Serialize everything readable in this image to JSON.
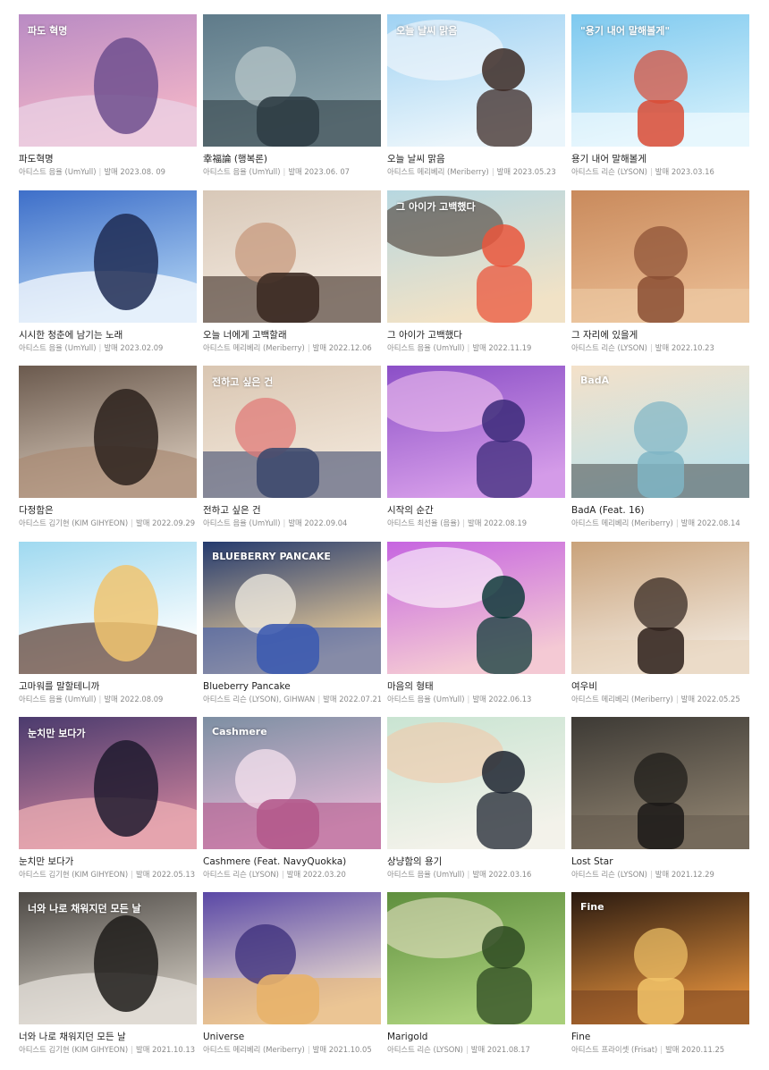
{
  "albums": [
    {
      "title": "파도혁명",
      "artist_label": "아티스트 음율 (UmYull)",
      "release_label": "발매 2023.08. 09",
      "cover_text": "파도 혁명",
      "colors": [
        "#b98bc4",
        "#f3b6c8",
        "#6f4f8e",
        "#e9d4e7"
      ]
    },
    {
      "title": "幸福論 (행복론)",
      "artist_label": "아티스트 음율 (UmYull)",
      "release_label": "발매 2023.06. 07",
      "cover_text": "",
      "colors": [
        "#5f7b8a",
        "#8fa6ad",
        "#2f3d45",
        "#b7c6c8"
      ]
    },
    {
      "title": "오늘 날씨 맑음",
      "artist_label": "아티스트 메리베리 (Meriberry)",
      "release_label": "발매 2023.05.23",
      "cover_text": "오늘 날씨 맑음",
      "colors": [
        "#9fd2f3",
        "#eaf5fb",
        "#3c2a25",
        "#f7f9fb"
      ]
    },
    {
      "title": "용기 내어 말해볼게",
      "artist_label": "아티스트 리슨 (LYSON)",
      "release_label": "발매 2023.03.16",
      "cover_text": "\"용기 내어 말해볼게\"",
      "colors": [
        "#7ec9ef",
        "#cfeefb",
        "#d94a34",
        "#ffffff"
      ]
    },
    {
      "title": "시시한 청춘에 남기는 노래",
      "artist_label": "아티스트 음율 (UmYull)",
      "release_label": "발매 2023.02.09",
      "cover_text": "",
      "colors": [
        "#3e6fc9",
        "#a9cdf1",
        "#1e2b54",
        "#ffffff"
      ]
    },
    {
      "title": "오늘 너에게 고백할래",
      "artist_label": "아티스트 메리베리 (Meriberry)",
      "release_label": "발매 2022.12.06",
      "cover_text": "",
      "colors": [
        "#d8c8b8",
        "#f3e9de",
        "#3b2a22",
        "#c79a7d"
      ]
    },
    {
      "title": "그 아이가 고백했다",
      "artist_label": "아티스트 음율 (UmYull)",
      "release_label": "발매 2022.11.19",
      "cover_text": "그 아이가 고백했다",
      "colors": [
        "#b7d7e0",
        "#f1e2c6",
        "#e9563c",
        "#4a3a32"
      ]
    },
    {
      "title": "그 자리에 있을게",
      "artist_label": "아티스트 리슨 (LYSON)",
      "release_label": "발매 2022.10.23",
      "cover_text": "",
      "colors": [
        "#c98a5c",
        "#e8b98f",
        "#8a4e33",
        "#f0d2ae"
      ]
    },
    {
      "title": "다정함은",
      "artist_label": "아티스트 김기현 (KIM GIHYEON)",
      "release_label": "발매 2022.09.29",
      "cover_text": "",
      "colors": [
        "#6b5a4e",
        "#d2c3b4",
        "#2b211c",
        "#a98a74"
      ]
    },
    {
      "title": "전하고 싶은 건",
      "artist_label": "아티스트 음율 (UmYull)",
      "release_label": "발매 2022.09.04",
      "cover_text": "전하고 싶은 건",
      "colors": [
        "#d9c6b2",
        "#f2e7da",
        "#3e4a6e",
        "#e07b78"
      ]
    },
    {
      "title": "시작의 순간",
      "artist_label": "아티스트 최선율 (음율)",
      "release_label": "발매 2022.08.19",
      "cover_text": "",
      "colors": [
        "#8b4fc7",
        "#d49be8",
        "#3b2a79",
        "#f3c4f0"
      ]
    },
    {
      "title": "BadA (Feat. 16)",
      "artist_label": "아티스트 메리베리 (Meriberry)",
      "release_label": "발매 2022.08.14",
      "cover_text": "BadA",
      "colors": [
        "#f4e1c9",
        "#bfe2ea",
        "#7fb5c4",
        "#3a3a3a"
      ]
    },
    {
      "title": "고마워를 말할테니까",
      "artist_label": "아티스트 음율 (UmYull)",
      "release_label": "발매 2022.08.09",
      "cover_text": "",
      "colors": [
        "#9fd9f0",
        "#ffffff",
        "#f0c470",
        "#5a3a2e"
      ]
    },
    {
      "title": "Blueberry Pancake",
      "artist_label": "아티스트 리슨 (LYSON), GIHWAN",
      "release_label": "발매 2022.07.21",
      "cover_text": "BLUEBERRY PANCAKE",
      "colors": [
        "#243a6e",
        "#f2d29a",
        "#3d5bb0",
        "#f5f0e4"
      ]
    },
    {
      "title": "마음의 형태",
      "artist_label": "아티스트 음율 (UmYull)",
      "release_label": "발매 2022.06.13",
      "cover_text": "",
      "colors": [
        "#c665e0",
        "#f4c9d4",
        "#0f3a3a",
        "#ffffff"
      ]
    },
    {
      "title": "여우비",
      "artist_label": "아티스트 메리베리 (Meriberry)",
      "release_label": "발매 2022.05.25",
      "cover_text": "",
      "colors": [
        "#c9a27a",
        "#f0e6da",
        "#2c1f1a",
        "#e6cfb6"
      ]
    },
    {
      "title": "눈치만 보다가",
      "artist_label": "아티스트 김기현 (KIM GIHYEON)",
      "release_label": "발매 2022.05.13",
      "cover_text": "눈치만 보다가",
      "colors": [
        "#4b3b6e",
        "#c9809a",
        "#1f1a2e",
        "#f1b4b7"
      ]
    },
    {
      "title": "Cashmere (Feat. NavyQuokka)",
      "artist_label": "아티스트 리슨 (LYSON)",
      "release_label": "발매 2022.03.20",
      "cover_text": "Cashmere",
      "colors": [
        "#7d8fa3",
        "#e4b9d6",
        "#b45a8c",
        "#f7e3ef"
      ]
    },
    {
      "title": "상냥함의 용기",
      "artist_label": "아티스트 음율 (UmYull)",
      "release_label": "발매 2022.03.16",
      "cover_text": "",
      "colors": [
        "#c9e4d2",
        "#f3f2ea",
        "#1d2430",
        "#f1c8a8"
      ]
    },
    {
      "title": "Lost Star",
      "artist_label": "아티스트 리슨 (LYSON)",
      "release_label": "발매 2021.12.29",
      "cover_text": "",
      "colors": [
        "#3d3a35",
        "#8a7e6c",
        "#1a1816",
        "#5f564a"
      ]
    },
    {
      "title": "너와 나로 채워지던 모든 날",
      "artist_label": "아티스트 김기현 (KIM GIHYEON)",
      "release_label": "발매 2021.10.13",
      "cover_text": "너와 나로 채워지던 모든 날",
      "colors": [
        "#4e4a46",
        "#c8c2b8",
        "#1f1c1a",
        "#eae6df"
      ]
    },
    {
      "title": "Universe",
      "artist_label": "아티스트 메리베리 (Meriberry)",
      "release_label": "발매 2021.10.05",
      "cover_text": "",
      "colors": [
        "#5a48a6",
        "#efe0d2",
        "#e8b36a",
        "#3a2c7a"
      ]
    },
    {
      "title": "Marigold",
      "artist_label": "아티스트 리슨 (LYSON)",
      "release_label": "발매 2021.08.17",
      "cover_text": "",
      "colors": [
        "#5f8f3e",
        "#a9cf7a",
        "#2e4a22",
        "#e8e2c6"
      ]
    },
    {
      "title": "Fine",
      "artist_label": "아티스트 프라이셋 (Frisat)",
      "release_label": "발매 2020.11.25",
      "cover_text": "Fine",
      "colors": [
        "#2a1a10",
        "#d98a3a",
        "#f2c46a",
        "#6b3a1e"
      ]
    }
  ]
}
